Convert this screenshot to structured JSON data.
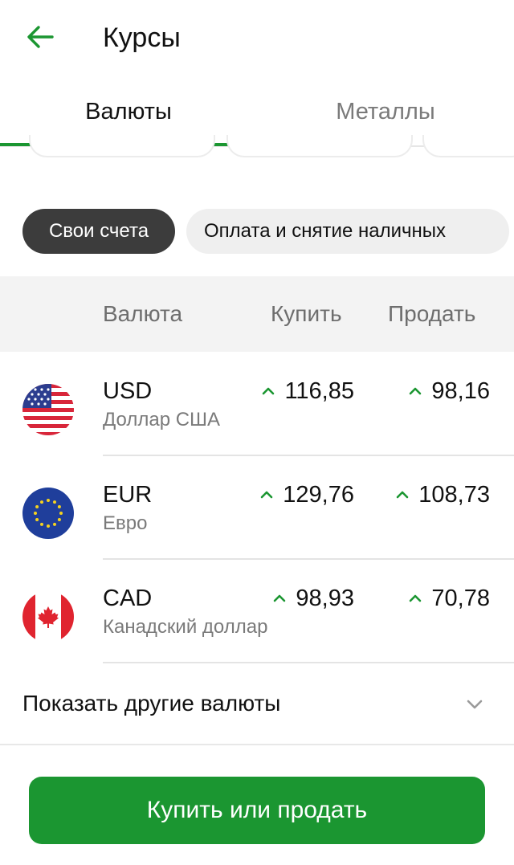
{
  "header": {
    "title": "Курсы"
  },
  "tabs": [
    {
      "label": "Валюты",
      "active": true
    },
    {
      "label": "Металлы",
      "active": false
    }
  ],
  "filters": [
    {
      "label": "Свои счета",
      "selected": true
    },
    {
      "label": "Оплата и снятие наличных",
      "selected": false
    }
  ],
  "table": {
    "headers": {
      "currency": "Валюта",
      "buy": "Купить",
      "sell": "Продать"
    },
    "rows": [
      {
        "code": "USD",
        "name": "Доллар США",
        "buy": "116,85",
        "sell": "98,16",
        "flag": "us-flag-icon"
      },
      {
        "code": "EUR",
        "name": "Евро",
        "buy": "129,76",
        "sell": "108,73",
        "flag": "eu-flag-icon"
      },
      {
        "code": "CAD",
        "name": "Канадский доллар",
        "buy": "98,93",
        "sell": "70,78",
        "flag": "ca-flag-icon"
      }
    ]
  },
  "more": {
    "label": "Показать другие валюты"
  },
  "cta": {
    "label": "Купить или продать"
  },
  "colors": {
    "accent": "#1b9631",
    "chip_selected": "#3c3c3c",
    "header_bg": "#f3f3f3"
  }
}
